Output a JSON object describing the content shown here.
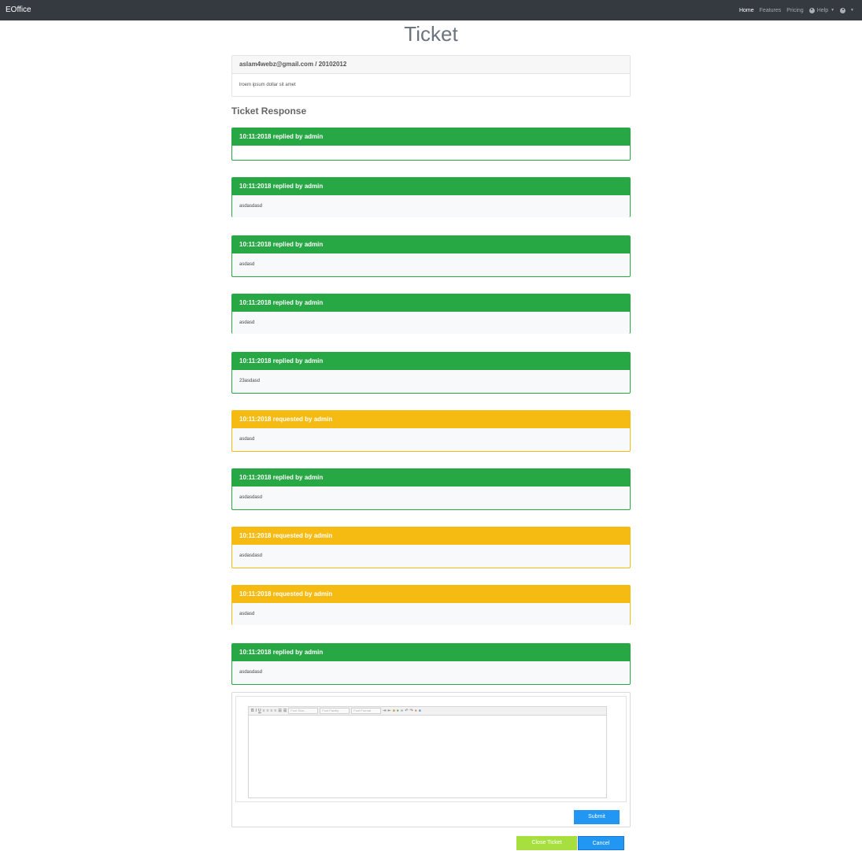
{
  "nav": {
    "brand": "EOffice",
    "links": [
      "Home",
      "Features",
      "Pricing"
    ],
    "help": "Help"
  },
  "page": {
    "title": "Ticket"
  },
  "ticket": {
    "header": "aslam4webz@gmail.com / 20102012",
    "body": "lroem ipsum dollar sit amet"
  },
  "responses_title": "Ticket Response",
  "responses": [
    {
      "header": "10:11:2018 replied by admin",
      "body": "",
      "status": "success"
    },
    {
      "header": "10:11:2018 replied by admin",
      "body": "asdasdasd",
      "status": "success"
    },
    {
      "header": "10:11:2018 replied by admin",
      "body": "asdasd",
      "status": "success"
    },
    {
      "header": "10:11:2018 replied by admin",
      "body": "asdasd",
      "status": "success"
    },
    {
      "header": "10:11:2018 replied by admin",
      "body": "23asdasd",
      "status": "success"
    },
    {
      "header": "10:11:2018 requested by admin",
      "body": "asdasd",
      "status": "warning"
    },
    {
      "header": "10:11:2018 replied by admin",
      "body": "asdasdasd",
      "status": "success"
    },
    {
      "header": "10:11:2018 requested by admin",
      "body": "asdasdasd",
      "status": "warning"
    },
    {
      "header": "10:11:2018 requested by admin",
      "body": "asdasd",
      "status": "warning"
    },
    {
      "header": "10:11:2018 replied by admin",
      "body": "asdasdasd",
      "status": "success"
    }
  ],
  "editor": {
    "toolbar_buttons": [
      "B",
      "I",
      "U"
    ],
    "font_size": "Font Size...",
    "font_family": "Font Family",
    "font_format": "Font Format"
  },
  "buttons": {
    "submit": "Submit",
    "close_ticket": "Close Ticket",
    "cancel": "Cancel"
  },
  "colors": {
    "success": "#28a745",
    "warning": "#f5bb13",
    "primary": "#2196f3",
    "close": "#a7e03e",
    "navbar": "#343a40"
  }
}
